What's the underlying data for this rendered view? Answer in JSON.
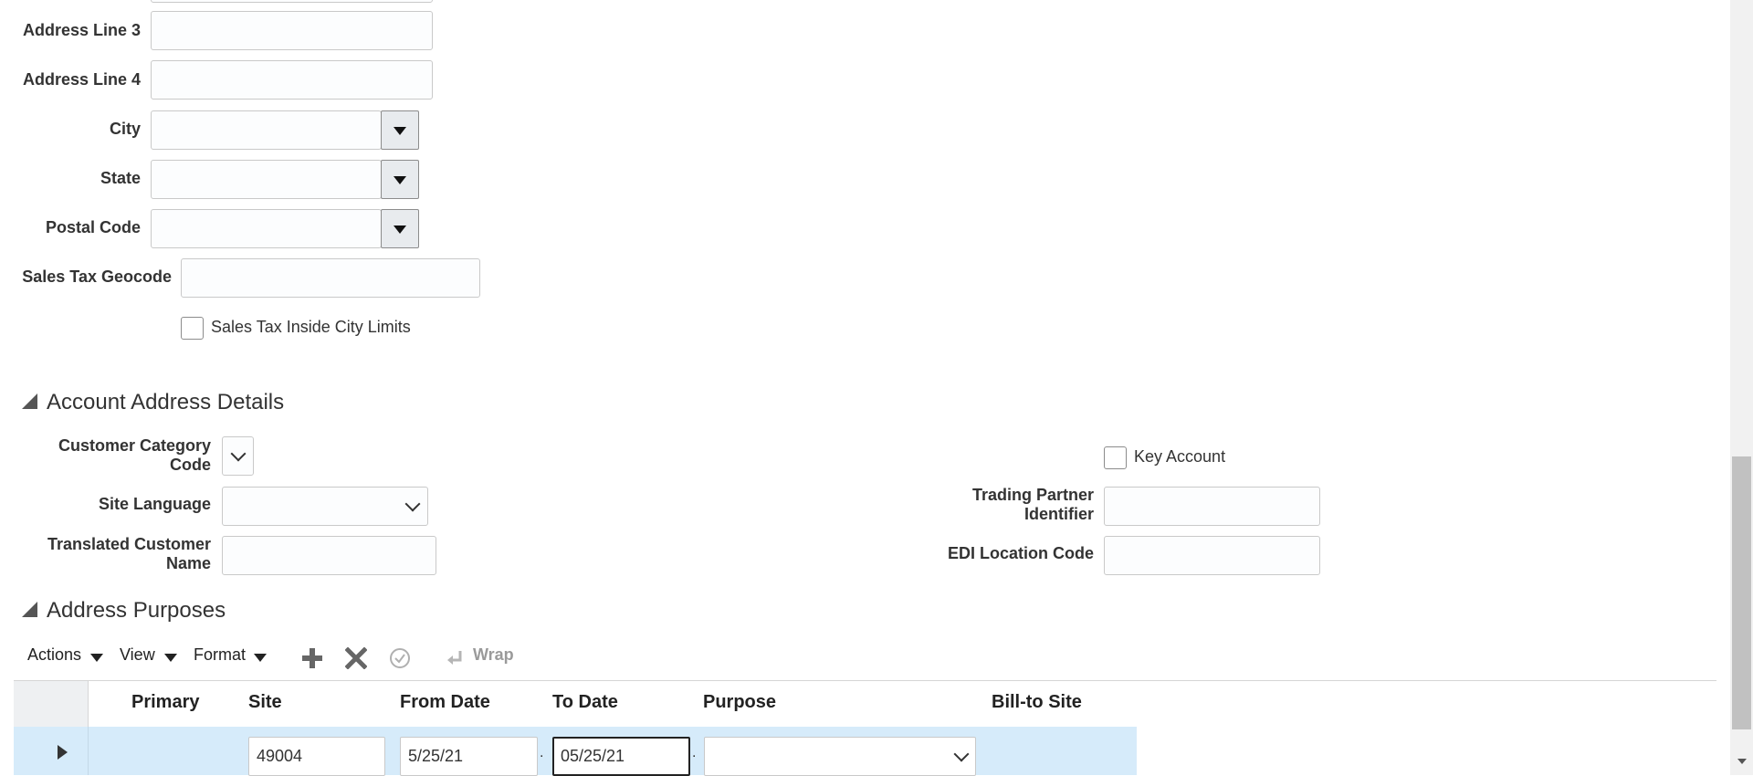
{
  "address": {
    "line3_label": "Address Line 3",
    "line4_label": "Address Line 4",
    "city_label": "City",
    "state_label": "State",
    "postal_label": "Postal Code",
    "geocode_label": "Sales Tax Geocode",
    "inside_city_label": "Sales Tax Inside City Limits"
  },
  "account_details": {
    "title": "Account Address Details",
    "customer_category_label": "Customer Category Code",
    "site_language_label": "Site Language",
    "translated_name_label": "Translated Customer Name",
    "key_account_label": "Key Account",
    "trading_partner_label": "Trading Partner Identifier",
    "edi_label": "EDI Location Code"
  },
  "purposes": {
    "title": "Address Purposes",
    "toolbar": {
      "actions": "Actions",
      "view": "View",
      "format": "Format",
      "wrap": "Wrap"
    },
    "columns": [
      "Primary",
      "Site",
      "From Date",
      "To Date",
      "Purpose",
      "Bill-to Site"
    ],
    "row": {
      "site": "49004",
      "from_date": "5/25/21",
      "to_date": "05/25/21",
      "purpose": ""
    }
  }
}
